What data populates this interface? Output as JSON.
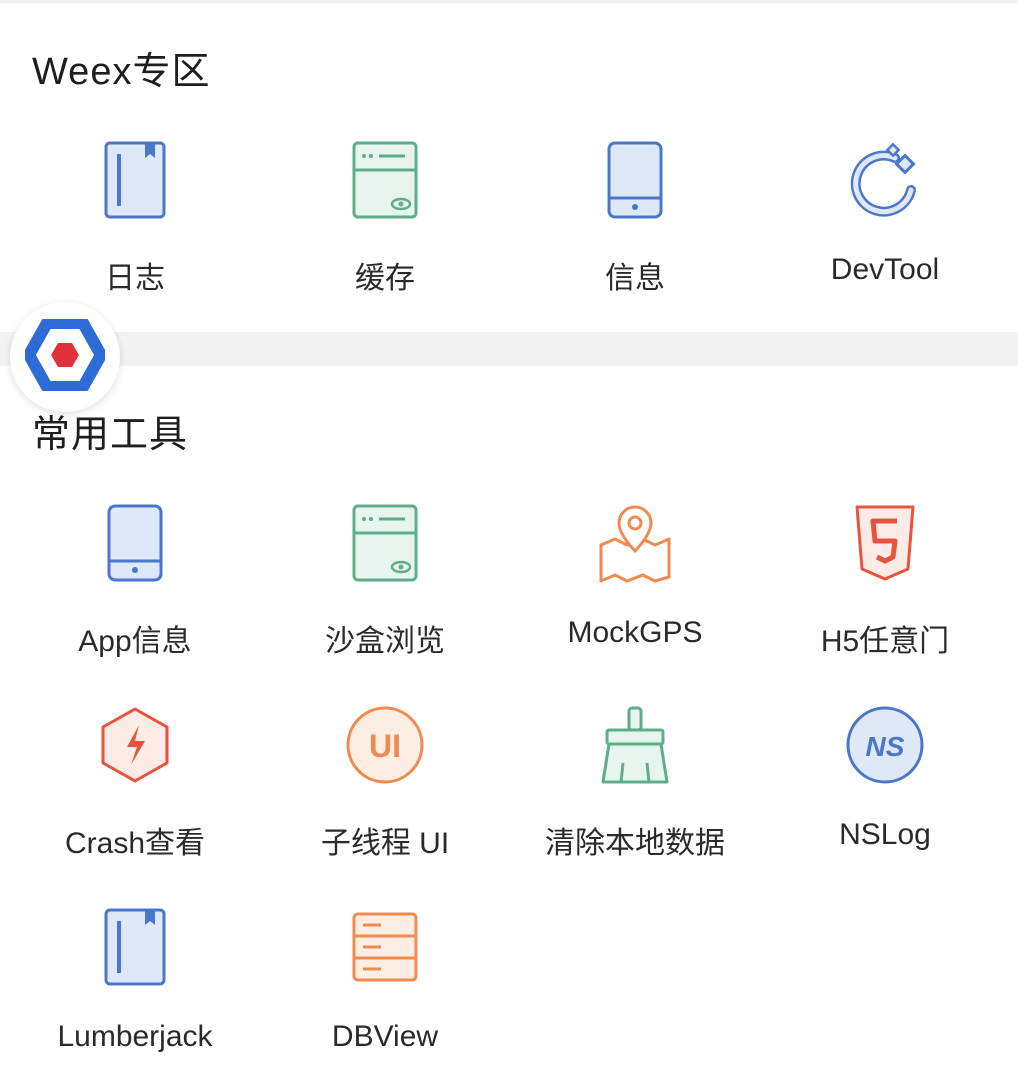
{
  "weex_section": {
    "title": "Weex专区",
    "items": [
      {
        "label": "日志",
        "icon": "book-icon"
      },
      {
        "label": "缓存",
        "icon": "storage-eye-icon"
      },
      {
        "label": "信息",
        "icon": "phone-icon"
      },
      {
        "label": "DevTool",
        "icon": "devtool-icon"
      }
    ]
  },
  "tools_section": {
    "title": "常用工具",
    "items": [
      {
        "label": "App信息",
        "icon": "phone-icon"
      },
      {
        "label": "沙盒浏览",
        "icon": "storage-eye-icon"
      },
      {
        "label": "MockGPS",
        "icon": "map-pin-icon"
      },
      {
        "label": "H5任意门",
        "icon": "html5-icon"
      },
      {
        "label": "Crash查看",
        "icon": "crash-icon"
      },
      {
        "label": "子线程 UI",
        "icon": "ui-badge-icon"
      },
      {
        "label": "清除本地数据",
        "icon": "broom-icon"
      },
      {
        "label": "NSLog",
        "icon": "ns-badge-icon"
      },
      {
        "label": "Lumberjack",
        "icon": "book-icon"
      },
      {
        "label": "DBView",
        "icon": "database-icon"
      }
    ]
  },
  "ui_badge_text": "UI",
  "ns_badge_text": "NS",
  "colors": {
    "blue": "#4a77c9",
    "blue_fill": "#dfe8f8",
    "green": "#5fae8a",
    "green_fill": "#e8f5ee",
    "orange": "#ef8a50",
    "red": "#e8533d"
  }
}
